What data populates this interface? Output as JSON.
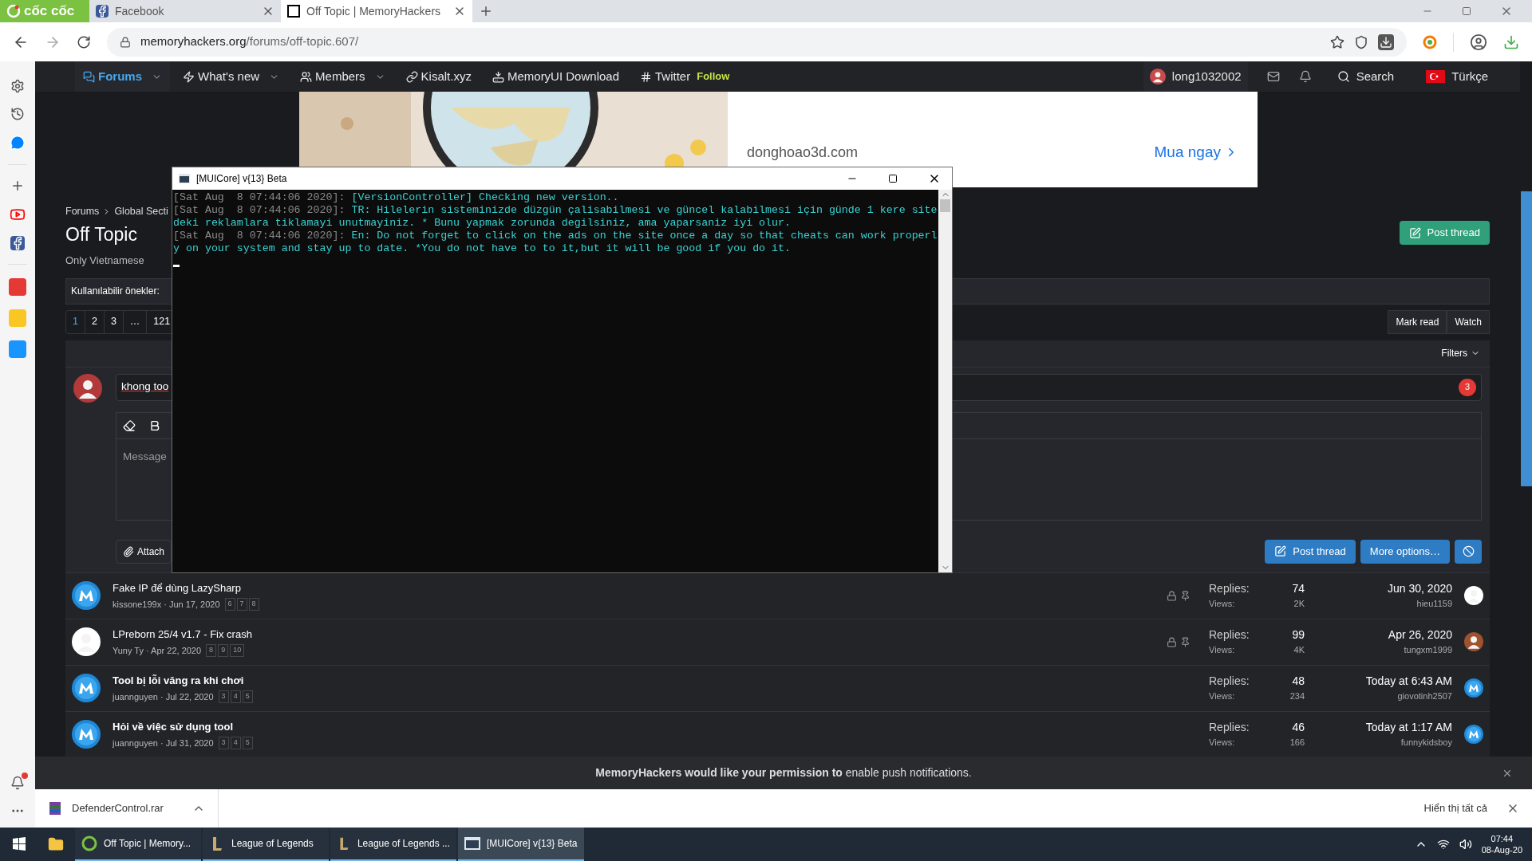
{
  "browser": {
    "brand": "cốc cốc",
    "tabs": [
      {
        "title": "Facebook",
        "kind": "facebook",
        "selected": false
      },
      {
        "title": "Off Topic | MemoryHackers",
        "kind": "site",
        "selected": true
      }
    ],
    "url_host": "memoryhackers.org",
    "url_path": "/forums/off-topic.607/"
  },
  "nav": {
    "items": [
      {
        "label": "Forums",
        "kind": "forums",
        "selected": true,
        "dropdown": true
      },
      {
        "label": "What's new",
        "kind": "bolt",
        "selected": false,
        "dropdown": true
      },
      {
        "label": "Members",
        "kind": "users",
        "selected": false,
        "dropdown": true
      },
      {
        "label": "Kisalt.xyz",
        "kind": "link",
        "selected": false,
        "dropdown": false
      },
      {
        "label": "MemoryUI Download",
        "kind": "download",
        "selected": false,
        "dropdown": false
      },
      {
        "label": "Twitter",
        "kind": "hash",
        "selected": false,
        "dropdown": false,
        "badge": "Follow"
      }
    ],
    "user": "long1032002",
    "search": "Search",
    "language": "Türkçe"
  },
  "ad": {
    "domain": "donghoao3d.com",
    "cta": "Mua ngay"
  },
  "breadcrumb": [
    "Forums",
    "Global Secti"
  ],
  "title": "Off Topic",
  "description": "Only Vietnamese",
  "prefixes_label": "Kullanılabilir önekler:",
  "pagination": [
    {
      "label": "1",
      "selected": true
    },
    {
      "label": "2",
      "selected": false
    },
    {
      "label": "3",
      "selected": false
    },
    {
      "label": "…",
      "selected": false
    },
    {
      "label": "121",
      "selected": false
    }
  ],
  "post_thread": "Post thread",
  "actions": [
    "Mark read",
    "Watch"
  ],
  "filters": "Filters",
  "quick_thread": {
    "title_value": "khong too",
    "badge": "3",
    "message_placeholder": "Message",
    "attach": "Attach",
    "buttons": [
      "Post thread",
      "More options…"
    ]
  },
  "threads": [
    {
      "title": "Fake IP để dùng LazySharp",
      "unread": false,
      "meta": "kissone199x · Jun 17, 2020",
      "pages": [
        "6",
        "7",
        "8"
      ],
      "locked": true,
      "sticky": true,
      "replies_label": "Replies:",
      "replies": "74",
      "views_label": "Views:",
      "views": "2K",
      "last_date": "Jun 30, 2020",
      "last_user": "hieu1159"
    },
    {
      "title": "LPreborn 25/4 v1.7 - Fix crash",
      "unread": false,
      "meta": "Yuny Ty · Apr 22, 2020",
      "pages": [
        "8",
        "9",
        "10"
      ],
      "locked": true,
      "sticky": true,
      "replies_label": "Replies:",
      "replies": "99",
      "views_label": "Views:",
      "views": "4K",
      "last_date": "Apr 26, 2020",
      "last_user": "tungxm1999"
    },
    {
      "title": "Tool bị lỗi văng ra khi chơi",
      "unread": true,
      "meta": "juannguyen · Jul 22, 2020",
      "pages": [
        "3",
        "4",
        "5"
      ],
      "locked": false,
      "sticky": false,
      "replies_label": "Replies:",
      "replies": "48",
      "views_label": "Views:",
      "views": "234",
      "last_date": "Today at 6:43 AM",
      "last_user": "giovotinh2507"
    },
    {
      "title": "Hỏi về việc sử dụng tool",
      "unread": true,
      "meta": "juannguyen · Jul 31, 2020",
      "pages": [
        "3",
        "4",
        "5"
      ],
      "locked": false,
      "sticky": false,
      "replies_label": "Replies:",
      "replies": "46",
      "views_label": "Views:",
      "views": "166",
      "last_date": "Today at 1:17 AM",
      "last_user": "funnykidsboy"
    }
  ],
  "notice": "**MemoryHackers would like your permission to** enable push notifications.",
  "download": {
    "file": "DefenderControl.rar",
    "show_all": "Hiển thị tất cả"
  },
  "console": {
    "title": "[MUICore] v{13} Beta",
    "lines": [
      {
        "stamp": "[Sat Aug  8 07:44:06 2020]: ",
        "text": "[VersionController] Checking new version.."
      },
      {
        "stamp": "[Sat Aug  8 07:44:06 2020]: ",
        "text": "TR: Hilelerin sisteminizde düzgün çalisabilmesi ve güncel kalabilmesi için günde 1 kere site"
      },
      {
        "text": "deki reklamlara tiklamayi unutmayiniz. * Bunu yapmak zorunda degilsiniz, ama yaparsaniz iyi olur."
      },
      {
        "stamp": "[Sat Aug  8 07:44:06 2020]: ",
        "text": "En: Do not forget to click on the ads on the site once a day so that cheats can work properl"
      },
      {
        "text": "y on your system and stay up to date. *You do not have to to it,but it will be good if you do it."
      }
    ]
  },
  "taskbar": {
    "items": [
      {
        "label": "Off Topic | Memory...",
        "kind": "browser",
        "selected": false
      },
      {
        "label": "League of Legends",
        "kind": "game",
        "selected": false
      },
      {
        "label": "League of Legends ...",
        "kind": "game",
        "selected": false
      },
      {
        "label": "[MUICore] v{13} Beta",
        "kind": "console",
        "selected": true
      }
    ],
    "time": "07:44",
    "date": "08-Aug-20"
  }
}
